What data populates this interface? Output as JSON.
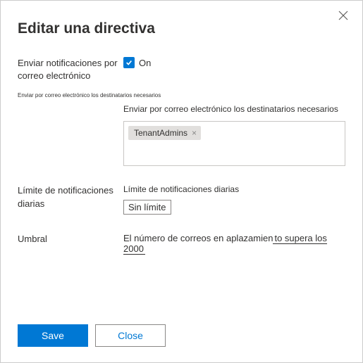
{
  "dialog": {
    "title": "Editar una directiva",
    "close_icon": "close"
  },
  "notifications": {
    "label": "Enviar notificaciones por correo electrónico",
    "checkbox_checked": true,
    "on_label": "On",
    "tiny_caption": "Enviar por correo electrónico los destinatarios necesarios",
    "recipients_label": "Enviar por correo electrónico los destinatarios necesarios",
    "chips": [
      {
        "label": "TenantAdmins"
      }
    ]
  },
  "daily_limit": {
    "label": "Límite de notificaciones diarias",
    "sub_label": "Límite de notificaciones diarias",
    "value": "Sin límite"
  },
  "threshold": {
    "label": "Umbral",
    "text_prefix": "El número de correos en aplazamien",
    "text_suffix": "to supera los 2000"
  },
  "buttons": {
    "save": "Save",
    "close": "Close"
  }
}
